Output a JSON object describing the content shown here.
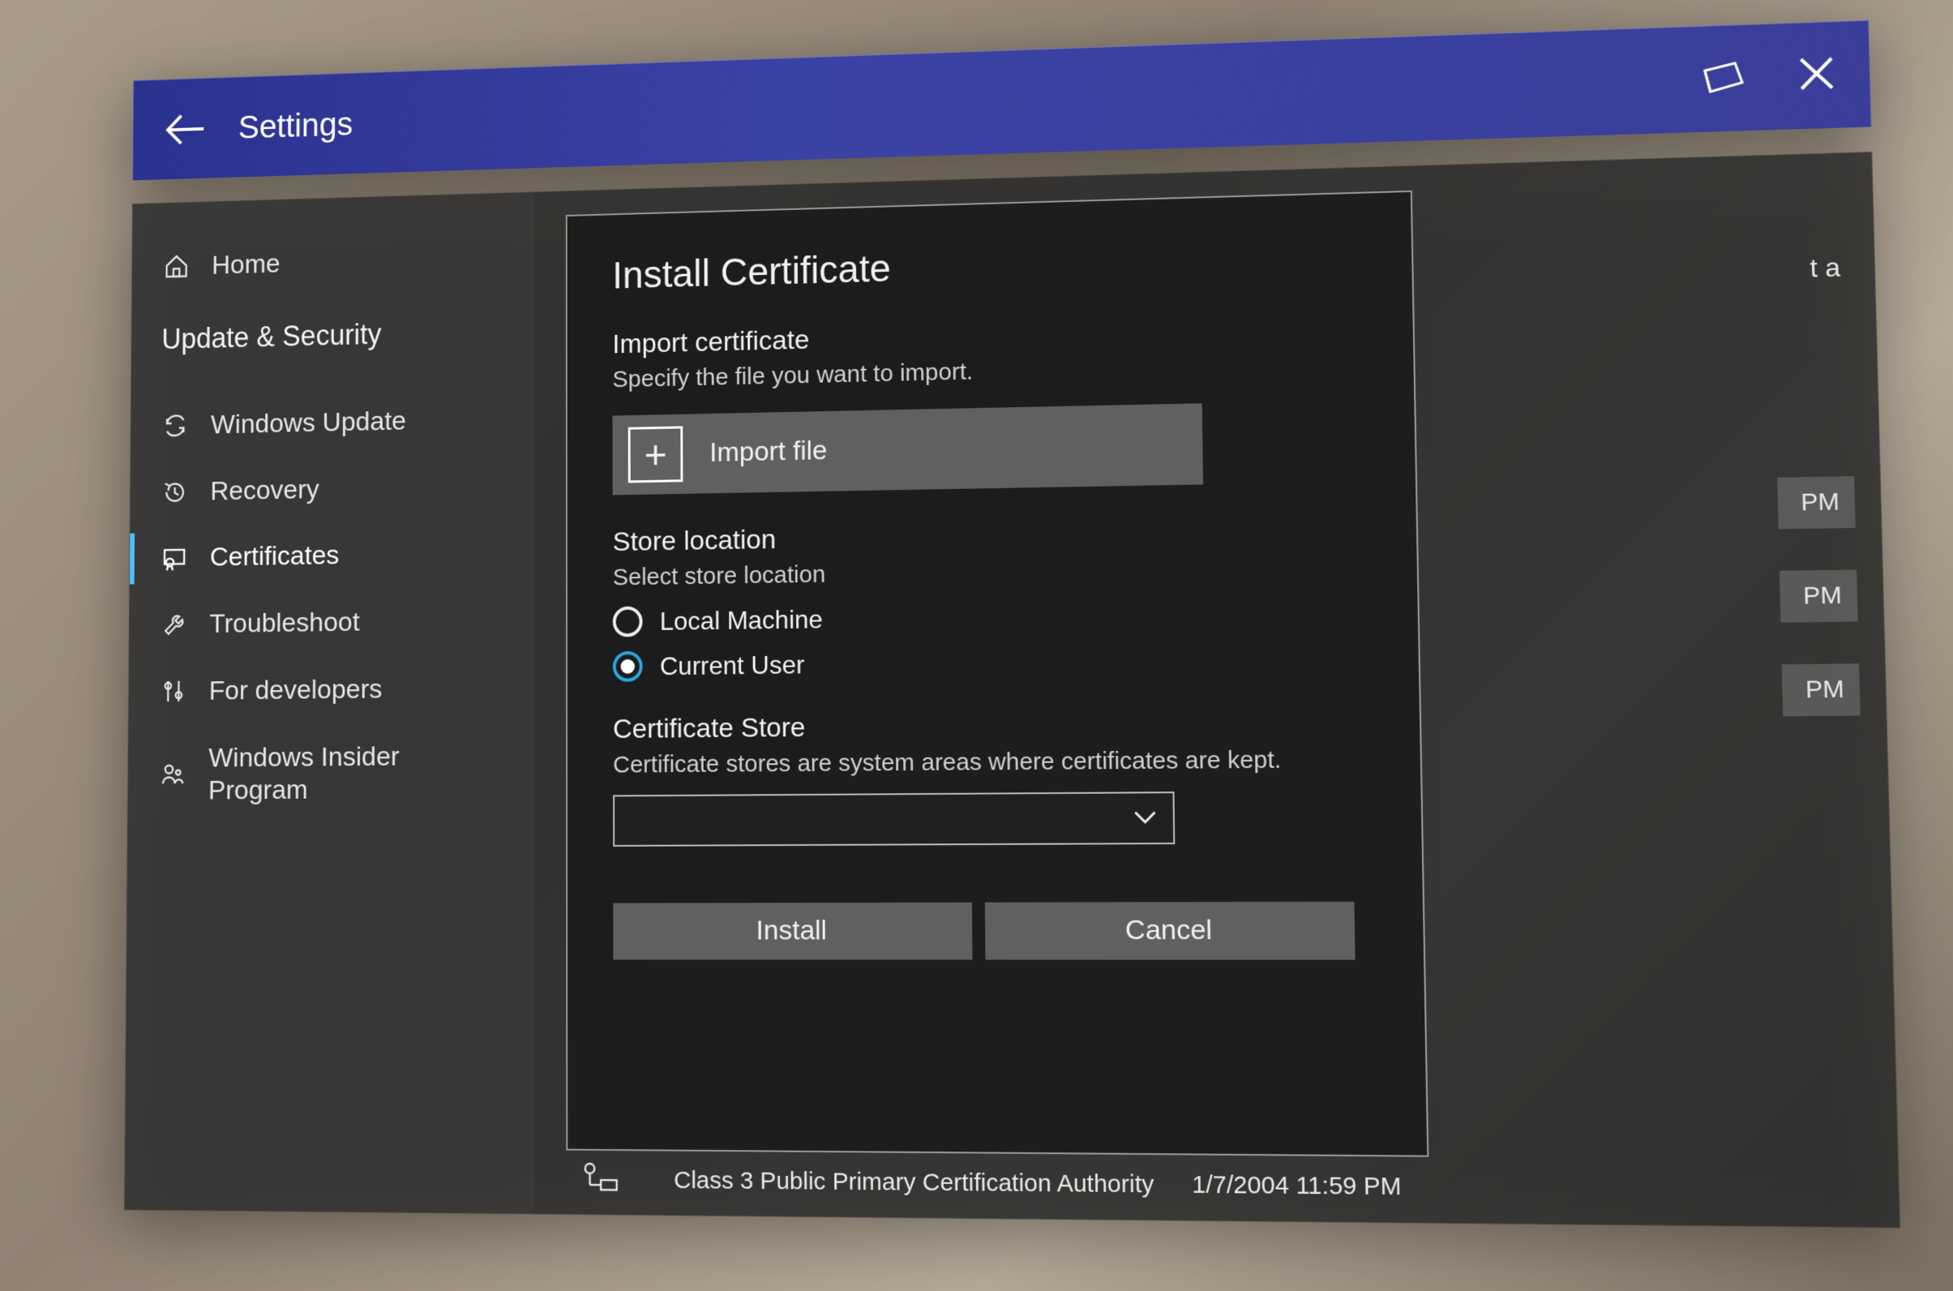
{
  "header": {
    "title": "Settings"
  },
  "sidebar": {
    "home": "Home",
    "section": "Update & Security",
    "items": [
      {
        "label": "Windows Update",
        "icon": "sync-icon"
      },
      {
        "label": "Recovery",
        "icon": "history-icon"
      },
      {
        "label": "Certificates",
        "icon": "certificate-icon",
        "selected": true
      },
      {
        "label": "Troubleshoot",
        "icon": "wrench-icon"
      },
      {
        "label": "For developers",
        "icon": "tools-icon"
      },
      {
        "label": "Windows Insider Program",
        "icon": "insider-icon"
      }
    ]
  },
  "dialog": {
    "title": "Install Certificate",
    "import_section_title": "Import certificate",
    "import_section_desc": "Specify the file you want to import.",
    "import_button": "Import file",
    "store_location_title": "Store location",
    "store_location_desc": "Select store location",
    "radio_local_machine": "Local Machine",
    "radio_current_user": "Current User",
    "selected_radio": "current_user",
    "cert_store_title": "Certificate Store",
    "cert_store_desc": "Certificate stores are system areas where certificates are kept.",
    "dropdown_value": "",
    "install_button": "Install",
    "cancel_button": "Cancel"
  },
  "background": {
    "top_hint": "t a",
    "right_rows": [
      "PM",
      "PM",
      "PM"
    ],
    "bottom_cert_name": "Class 3 Public Primary Certification Authority",
    "bottom_cert_date": "1/7/2004 11:59 PM"
  }
}
